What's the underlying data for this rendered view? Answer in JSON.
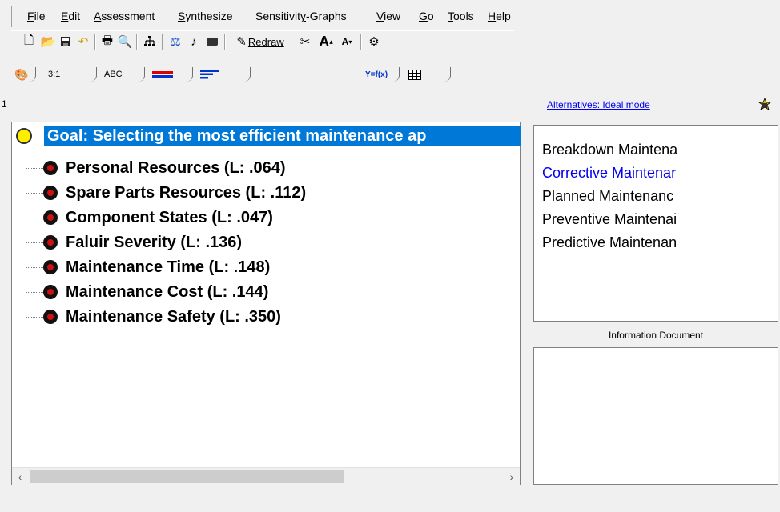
{
  "menu": {
    "items": [
      "File",
      "Edit",
      "Assessment",
      "Synthesize",
      "Sensitivity-Graphs",
      "View",
      "Go",
      "Tools",
      "Help"
    ]
  },
  "toolbar": {
    "redraw_label": "Redraw",
    "icons": [
      "new-file-icon",
      "open-folder-icon",
      "save-icon",
      "undo-icon",
      "print-icon",
      "print-preview-icon",
      "hierarchy-icon",
      "scale-icon",
      "note-icon",
      "rectangle-icon",
      "redraw-icon",
      "cut-icon",
      "font-larger-icon",
      "font-smaller-icon",
      "help-icon"
    ]
  },
  "tabs": {
    "labels": [
      "3:1",
      "ABC",
      "Y=f(x)"
    ],
    "icons": [
      "colors-icon",
      "equals-icon",
      "lines-icon",
      "table-icon"
    ]
  },
  "left_header": {
    "value": "1"
  },
  "tree": {
    "goal": "Goal: Selecting the most efficient maintenance ap",
    "nodes": [
      "Personal Resources (L: .064)",
      "Spare Parts Resources (L: .112)",
      "Component States (L: .047)",
      "Faluir Severity (L: .136)",
      "Maintenance Time (L: .148)",
      "Maintenance Cost (L: .144)",
      "Maintenance Safety (L: .350)"
    ]
  },
  "alternatives": {
    "header_link": "Alternatives: Ideal mode",
    "items": [
      "Breakdown Maintena",
      "Corrective Maintenar",
      "Planned Maintenanc",
      "Preventive Maintenai",
      "Predictive Maintenan"
    ],
    "selected_color": "#0000ee"
  },
  "info_document": {
    "title": "Information Document"
  },
  "colors": {
    "selection": "#0078d7",
    "goal_circle": "#ffee00",
    "node_dot": "#d01010"
  }
}
